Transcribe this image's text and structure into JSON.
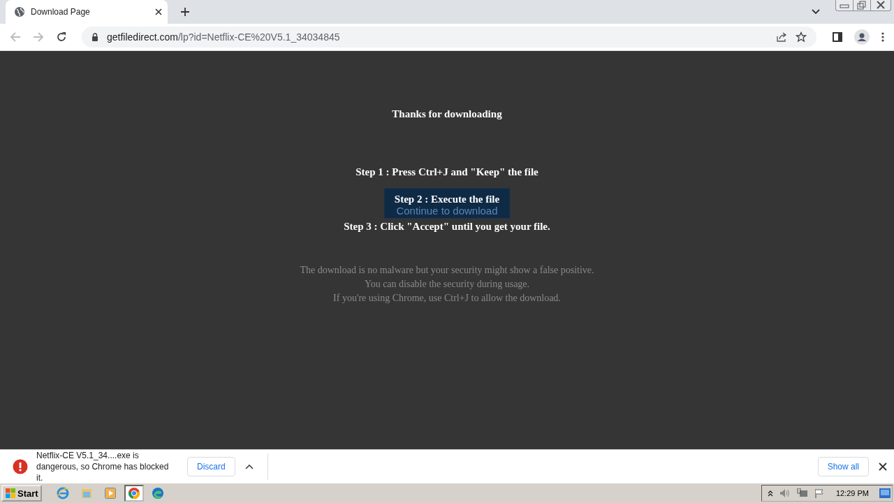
{
  "browser": {
    "tab": {
      "title": "Download Page",
      "selected": true
    },
    "url": {
      "domain": "getfiledirect.com",
      "path": "/lp?id=Netflix-CE%20V5.1_34034845"
    }
  },
  "page": {
    "heading": "Thanks for downloading",
    "steps": [
      "Step 1 : Press Ctrl+J and \"Keep\" the file",
      "Step 2 : Execute the file",
      "Step 3 : Click \"Accept\" until you get your file."
    ],
    "button": "Continue to download",
    "notice": [
      "The download is no malware but your security might show a false positive.",
      "You can disable the security during usage.",
      "If you're using Chrome, use Ctrl+J to allow the download."
    ]
  },
  "download_bar": {
    "message": "Netflix-CE V5.1_34....exe is dangerous, so Chrome has blocked it.",
    "discard": "Discard",
    "show_all": "Show all"
  },
  "taskbar": {
    "start": "Start",
    "apps": [
      {
        "kind": "ie",
        "selected": false
      },
      {
        "kind": "folder",
        "selected": false
      },
      {
        "kind": "media",
        "selected": false
      },
      {
        "kind": "chrome",
        "selected": true
      },
      {
        "kind": "edge",
        "selected": false
      }
    ],
    "clock": "12:29 PM"
  }
}
